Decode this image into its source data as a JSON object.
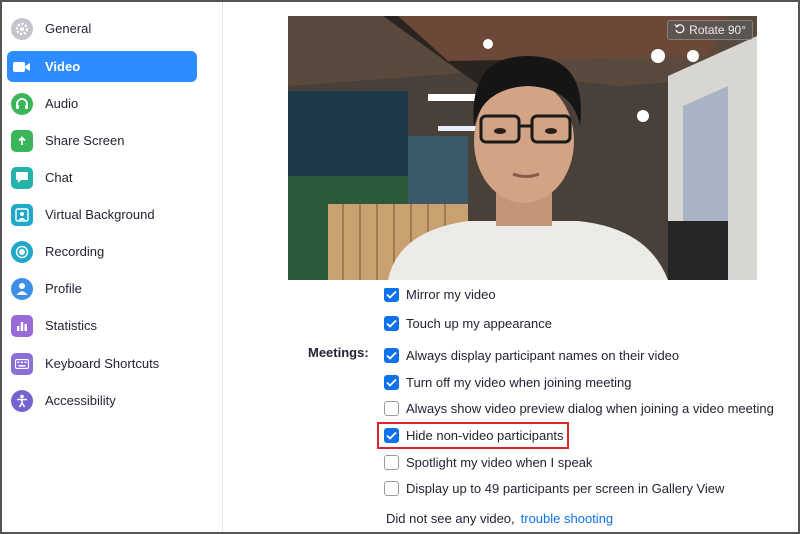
{
  "sidebar": {
    "items": [
      {
        "label": "General",
        "icon": "gear-icon",
        "color": "#b6b6be"
      },
      {
        "label": "Video",
        "icon": "video-camera-icon",
        "color": "#2d8cff",
        "active": true
      },
      {
        "label": "Audio",
        "icon": "headphones-icon",
        "color": "#3ab55a"
      },
      {
        "label": "Share Screen",
        "icon": "share-screen-icon",
        "color": "#3ab55a"
      },
      {
        "label": "Chat",
        "icon": "chat-bubble-icon",
        "color": "#24b3a8"
      },
      {
        "label": "Virtual Background",
        "icon": "person-background-icon",
        "color": "#1fa8c9"
      },
      {
        "label": "Recording",
        "icon": "record-icon",
        "color": "#1fa8c9"
      },
      {
        "label": "Profile",
        "icon": "user-icon",
        "color": "#3c8ee6"
      },
      {
        "label": "Statistics",
        "icon": "bar-chart-icon",
        "color": "#9a6ad6"
      },
      {
        "label": "Keyboard Shortcuts",
        "icon": "keyboard-icon",
        "color": "#8a70d6"
      },
      {
        "label": "Accessibility",
        "icon": "accessibility-icon",
        "color": "#7563cf"
      }
    ]
  },
  "preview": {
    "rotate_label": "Rotate 90°"
  },
  "options": {
    "mirror": {
      "label": "Mirror my video",
      "checked": true
    },
    "touch_up": {
      "label": "Touch up my appearance",
      "checked": true
    }
  },
  "meetings": {
    "section_label": "Meetings:",
    "items": [
      {
        "label": "Always display participant names on their video",
        "checked": true
      },
      {
        "label": "Turn off my video when joining meeting",
        "checked": true
      },
      {
        "label": "Always show video preview dialog when joining a video meeting",
        "checked": false
      },
      {
        "label": "Hide non-video participants",
        "checked": true,
        "highlighted": true
      },
      {
        "label": "Spotlight my video when I speak",
        "checked": false
      },
      {
        "label": "Display up to 49 participants per screen in Gallery View",
        "checked": false
      }
    ]
  },
  "footer": {
    "text": "Did not see any video,",
    "link": "trouble shooting"
  },
  "colors": {
    "accent": "#2d8cff",
    "checkbox": "#0e72ed",
    "highlight_border": "#e0242b"
  }
}
